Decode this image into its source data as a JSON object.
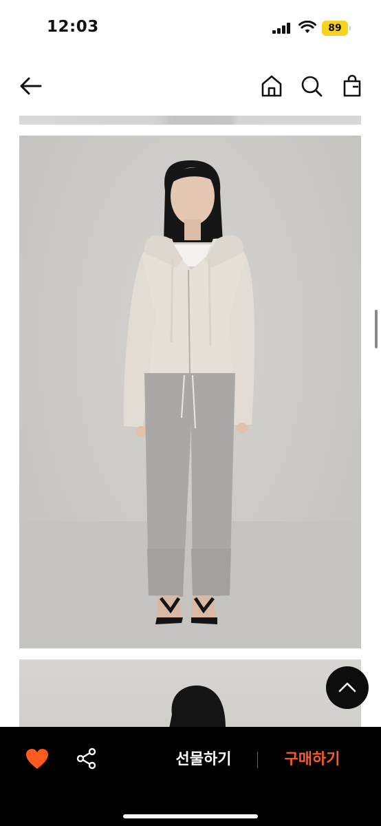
{
  "status_bar": {
    "time": "12:03",
    "battery": "89",
    "battery_color": "#f7d21e"
  },
  "nav": {
    "back_icon": "arrow-left-icon",
    "home_icon": "home-icon",
    "search_icon": "search-icon",
    "bag_icon": "shopping-bag-icon"
  },
  "content": {
    "image_alt_1": "product-photo",
    "image_alt_2": "product-photo"
  },
  "bottom_bar": {
    "like_icon": "heart-icon",
    "like_color": "#ff5a1f",
    "share_icon": "share-icon",
    "gift_label": "선물하기",
    "buy_label": "구매하기",
    "buy_color": "#ff5a1f"
  },
  "scroll_top_icon": "chevron-up-icon"
}
